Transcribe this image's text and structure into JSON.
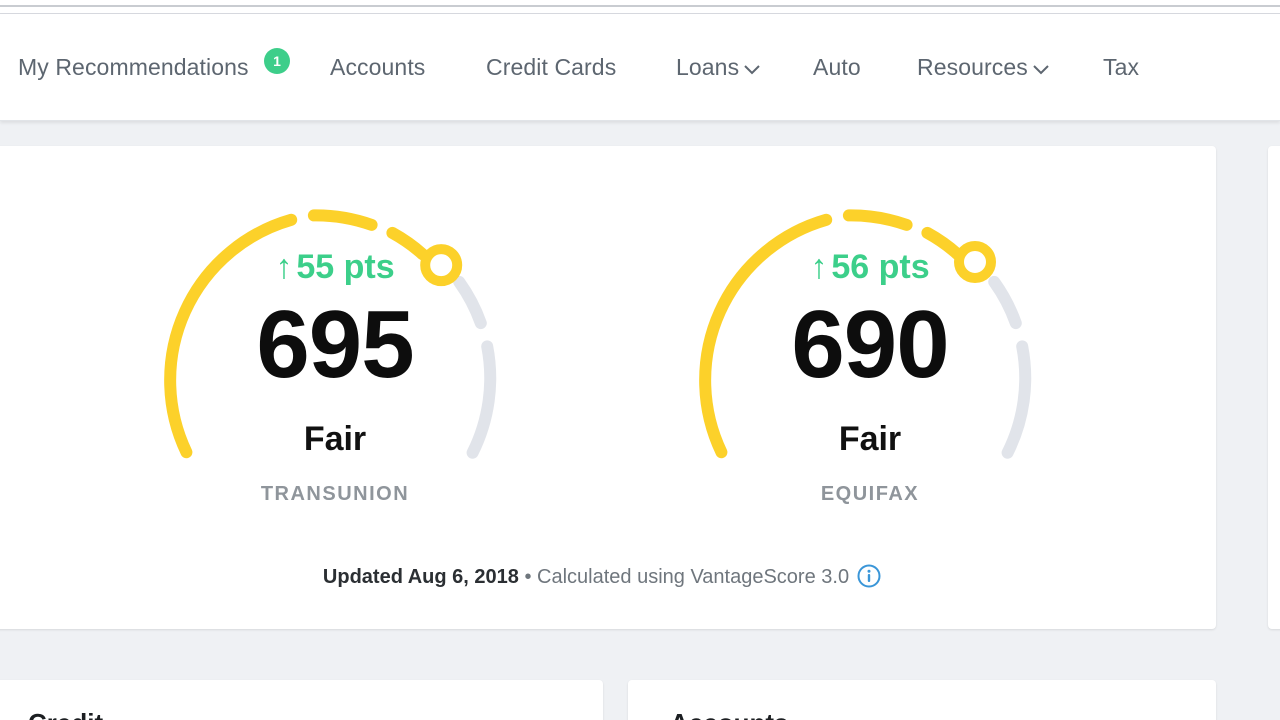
{
  "colors": {
    "accent_yellow": "#fcd12a",
    "gauge_gray": "#e1e4ea",
    "positive_green": "#3ccf8a",
    "info_blue": "#3a96d8"
  },
  "nav": {
    "items": [
      {
        "label": "My Recommendations",
        "badge": "1",
        "dropdown": false
      },
      {
        "label": "Accounts",
        "dropdown": false
      },
      {
        "label": "Credit Cards",
        "dropdown": false
      },
      {
        "label": "Loans",
        "dropdown": true
      },
      {
        "label": "Auto",
        "dropdown": false
      },
      {
        "label": "Resources",
        "dropdown": true
      },
      {
        "label": "Tax",
        "dropdown": false
      }
    ]
  },
  "scores": [
    {
      "bureau": "TRANSUNION",
      "score": "695",
      "rating": "Fair",
      "delta_arrow": "↑",
      "delta": "55 pts"
    },
    {
      "bureau": "EQUIFAX",
      "score": "690",
      "rating": "Fair",
      "delta_arrow": "↑",
      "delta": "56 pts"
    }
  ],
  "footer": {
    "updated": "Updated Aug 6, 2018",
    "separator": " • ",
    "calc": "Calculated using VantageScore 3.0",
    "info_icon": "info-icon"
  },
  "lower_cards": [
    {
      "title": "Credit"
    },
    {
      "title": "Accounts"
    }
  ]
}
